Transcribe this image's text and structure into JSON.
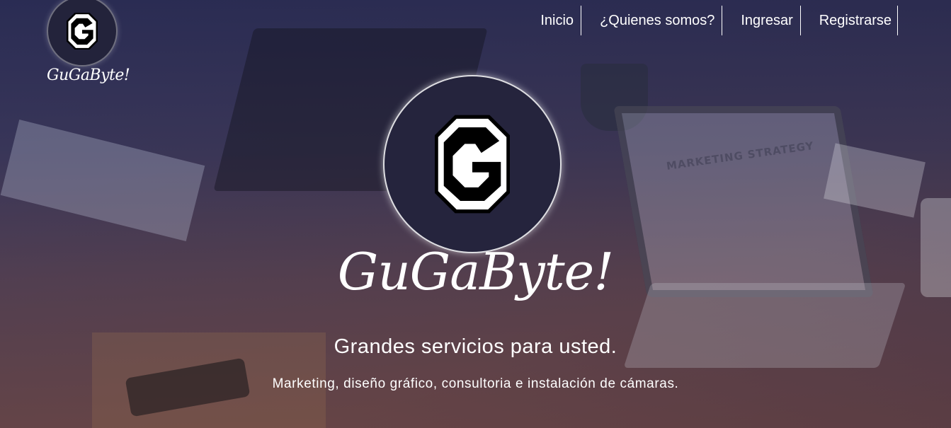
{
  "header": {
    "brand_name": "GuGaByte!",
    "logo_icon": "g-octagon-logo-icon"
  },
  "nav": {
    "items": [
      {
        "label": "Inicio"
      },
      {
        "label": "¿Quienes somos?"
      },
      {
        "label": "Ingresar"
      },
      {
        "label": "Registrarse"
      }
    ]
  },
  "hero": {
    "logo_icon": "g-octagon-logo-icon",
    "title": "GuGaByte!",
    "subtitle": "Grandes servicios para usted.",
    "description": "Marketing, diseño gráfico, consultoria e instalación de cámaras."
  },
  "background": {
    "laptop_screen_text": "MARKETING STRATEGY"
  },
  "colors": {
    "overlay_top": "#262850",
    "overlay_bottom": "#603e46",
    "text": "#ffffff",
    "logo_bg": "#25243d"
  }
}
